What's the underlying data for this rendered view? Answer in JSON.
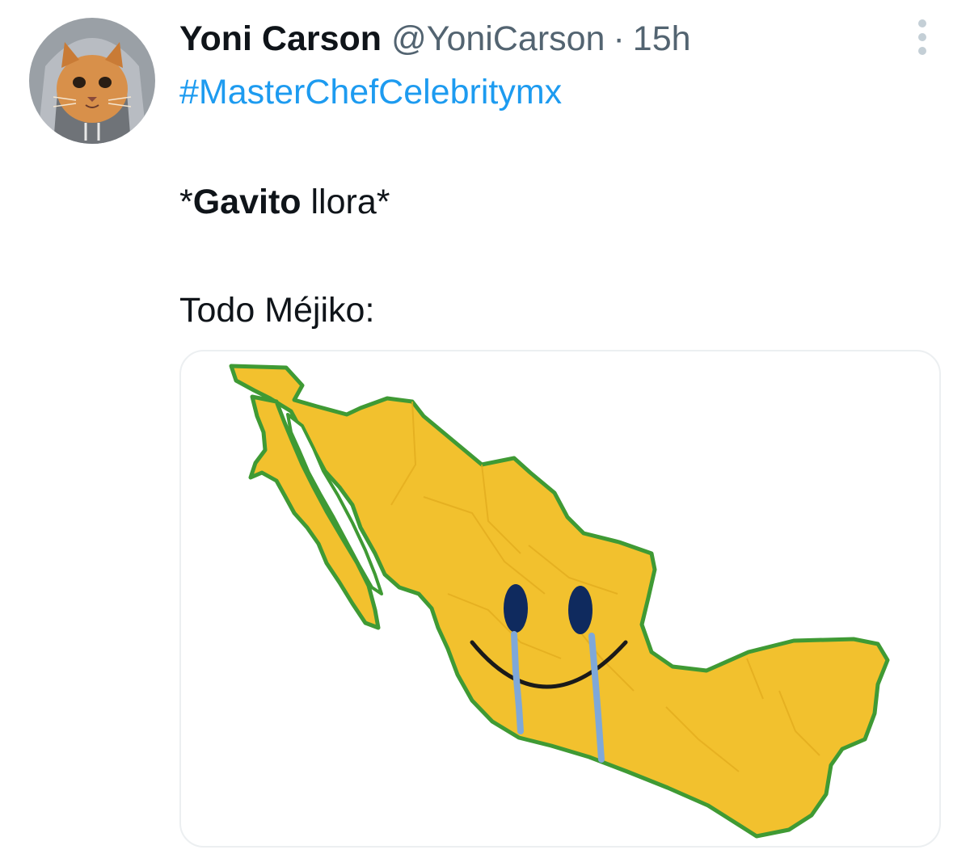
{
  "tweet": {
    "display_name": "Yoni Carson",
    "handle": "@YoniCarson",
    "separator": "·",
    "time": "15h",
    "hashtag": "#MasterChefCelebritymx",
    "line1_prefix": "*",
    "line1_bold": "Gavito",
    "line1_suffix": " llora*",
    "line2": "Todo Méjiko:"
  },
  "icons": {
    "avatar": "cat-in-hoodie-avatar",
    "more": "more-vertical-icon",
    "media": "mexico-map-crying-smiley"
  },
  "colors": {
    "hashtag": "#1d9bf0",
    "secondary_text": "#536471",
    "map_fill": "#f2c12e",
    "map_outline": "#3f9a34",
    "eyes": "#0f2a5e",
    "tears": "#7fa8d8"
  }
}
